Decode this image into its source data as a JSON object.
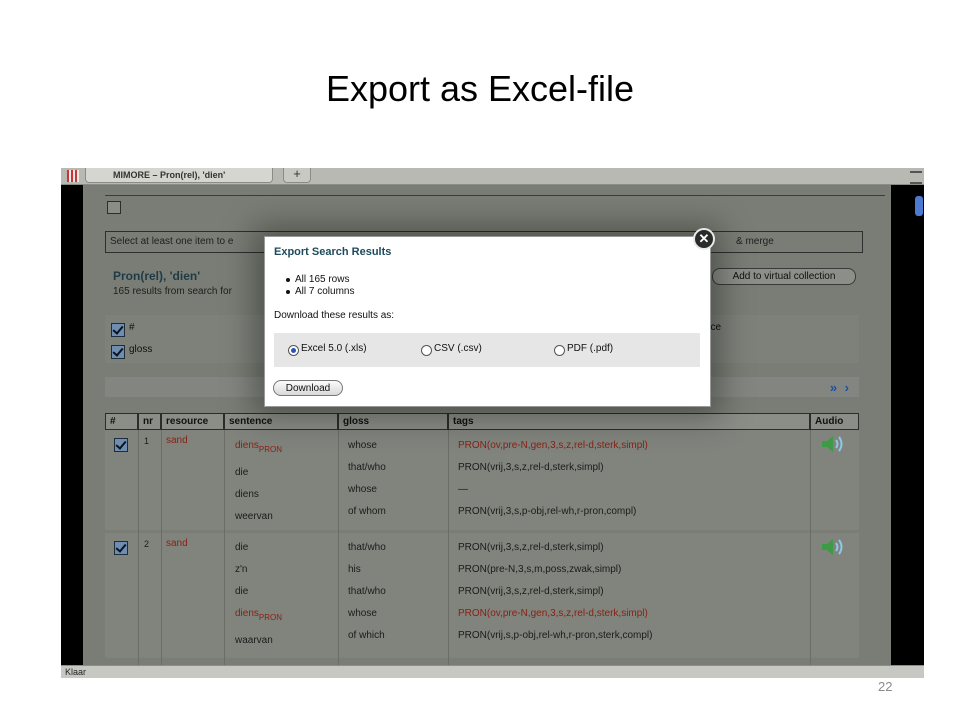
{
  "slide": {
    "title": "Export as Excel-file",
    "page_number": "22"
  },
  "browser": {
    "tab_title": "MIMORE – Pron(rel), 'dien'",
    "new_tab": "+",
    "status": "Klaar"
  },
  "app": {
    "info_text": "Select at least one item to e",
    "info_text_right": "& merge",
    "result_title": "Pron(rel), 'dien'",
    "result_subtitle": "165 results from search for",
    "add_virtual_collection": "Add to virtual collection",
    "columns": [
      {
        "label": "#",
        "checked": true
      },
      {
        "label": "gloss",
        "checked": true
      },
      {
        "label": "nce",
        "checked": true
      }
    ],
    "pager_arrows": "» ›"
  },
  "table": {
    "headers": [
      "#",
      "nr",
      "resource",
      "sentence",
      "gloss",
      "tags",
      "Audio"
    ],
    "rows": [
      {
        "nr": "1",
        "resource": "sand",
        "lines": [
          {
            "sentence": "diens",
            "sub": "PRON",
            "gloss": "whose",
            "tags": "PRON(ov,pre-N,gen,3,s,z,rel-d,sterk,simpl)",
            "highlight": true
          },
          {
            "sentence": "die",
            "sub": "",
            "gloss": "that/who",
            "tags": "PRON(vrij,3,s,z,rel-d,sterk,simpl)",
            "highlight": false
          },
          {
            "sentence": "diens",
            "sub": "",
            "gloss": "whose",
            "tags": "—",
            "highlight": false
          },
          {
            "sentence": "weervan",
            "sub": "",
            "gloss": "of whom",
            "tags": "PRON(vrij,3,s,p-obj,rel-wh,r-pron,compl)",
            "highlight": false
          }
        ]
      },
      {
        "nr": "2",
        "resource": "sand",
        "lines": [
          {
            "sentence": "die",
            "sub": "",
            "gloss": "that/who",
            "tags": "PRON(vrij,3,s,z,rel-d,sterk,simpl)",
            "highlight": false
          },
          {
            "sentence": "z'n",
            "sub": "",
            "gloss": "his",
            "tags": "PRON(pre-N,3,s,m,poss,zwak,simpl)",
            "highlight": false
          },
          {
            "sentence": "die",
            "sub": "",
            "gloss": "that/who",
            "tags": "PRON(vrij,3,s,z,rel-d,sterk,simpl)",
            "highlight": false
          },
          {
            "sentence": "diens",
            "sub": "PRON",
            "gloss": "whose",
            "tags": "PRON(ov,pre-N,gen,3,s,z,rel-d,sterk,simpl)",
            "highlight": true
          },
          {
            "sentence": "waarvan",
            "sub": "",
            "gloss": "of which",
            "tags": "PRON(vrij,s,p-obj,rel-wh,r-pron,sterk,compl)",
            "highlight": false
          }
        ]
      }
    ]
  },
  "modal": {
    "title": "Export Search Results",
    "bullets": [
      "All 165 rows",
      "All 7 columns"
    ],
    "prompt": "Download these results as:",
    "formats": [
      {
        "label": "Excel 5.0 (.xls)",
        "selected": true
      },
      {
        "label": "CSV (.csv)",
        "selected": false
      },
      {
        "label": "PDF (.pdf)",
        "selected": false
      }
    ],
    "download_label": "Download",
    "close_glyph": "✕"
  },
  "colors": {
    "accent": "#1d4a5c",
    "highlight_text": "#8a1f12",
    "radio_selected": "#2b55b5"
  }
}
